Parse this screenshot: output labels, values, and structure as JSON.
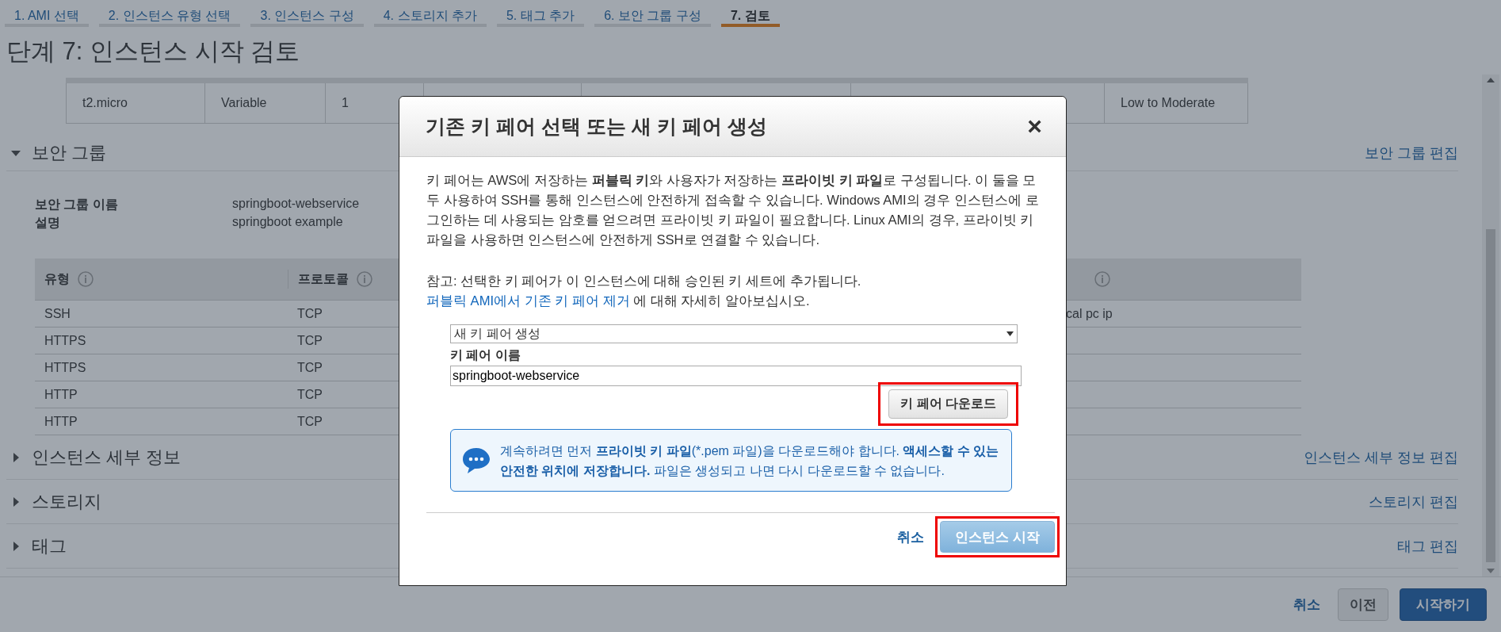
{
  "tabs": [
    {
      "label": "1. AMI 선택",
      "selected": false
    },
    {
      "label": "2. 인스턴스 유형 선택",
      "selected": false
    },
    {
      "label": "3. 인스턴스 구성",
      "selected": false
    },
    {
      "label": "4. 스토리지 추가",
      "selected": false
    },
    {
      "label": "5. 태그 추가",
      "selected": false
    },
    {
      "label": "6. 보안 그룹 구성",
      "selected": false
    },
    {
      "label": "7. 검토",
      "selected": true
    }
  ],
  "page_title": "단계 7: 인스턴스 시작 검토",
  "instance_table": {
    "rows": [
      [
        "t2.micro",
        "Variable",
        "1",
        null,
        null,
        null,
        "Low to Moderate"
      ]
    ]
  },
  "sections": [
    {
      "title": "보안 그룹",
      "expanded": true,
      "edit_link": "보안 그룹 편집",
      "details": [
        {
          "label": "보안 그룹 이름",
          "value": "springboot-webservice"
        },
        {
          "label": "설명",
          "value": "springboot example"
        }
      ],
      "rules_table": {
        "columns": [
          {
            "label": "유형",
            "info": true
          },
          {
            "label": "프로토콜",
            "info": true
          },
          {
            "info": true
          }
        ],
        "rows": [
          [
            "SSH",
            "TCP",
            "cal pc ip"
          ],
          [
            "HTTPS",
            "TCP",
            null
          ],
          [
            "HTTPS",
            "TCP",
            null
          ],
          [
            "HTTP",
            "TCP",
            null
          ],
          [
            "HTTP",
            "TCP",
            null
          ]
        ]
      }
    },
    {
      "title": "인스턴스 세부 정보",
      "expanded": false,
      "edit_link": "인스턴스 세부 정보 편집"
    },
    {
      "title": "스토리지",
      "expanded": false,
      "edit_link": "스토리지 편집"
    },
    {
      "title": "태그",
      "expanded": false,
      "edit_link": "태그 편집"
    }
  ],
  "footer": {
    "cancel": "취소",
    "previous": "이전",
    "launch": "시작하기"
  },
  "modal": {
    "title": "기존 키 페어 선택 또는 새 키 페어 생성",
    "close": "×",
    "intro": "키 페어는 AWS에 저장하는 **퍼블릭 키**와 사용자가 저장하는 **프라이빗 키 파일**로 구성됩니다. 이 둘을 모두 사용하여 SSH를 통해 인스턴스에 안전하게 접속할 수 있습니다. Windows AMI의 경우 인스턴스에 로그인하는 데 사용되는 암호를 얻으려면 프라이빗 키 파일이 필요합니다. Linux AMI의 경우, 프라이빗 키 파일을 사용하면 인스턴스에 안전하게 SSH로 연결할 수 있습니다.",
    "note": {
      "before": "참고: 선택한 키 페어가 이 인스턴스에 대해 승인된 키 세트에 추가됩니다.",
      "link": "퍼블릭 AMI에서 기존 키 페어 제거",
      "after": "에 대해 자세히 알아보십시오."
    },
    "key_pair_select": {
      "value": "새 키 페어 생성"
    },
    "key_pair_name": {
      "label": "키 페어 이름",
      "value": "springboot-webservice"
    },
    "download_button": {
      "label": "키 페어 다운로드",
      "highlighted": true
    },
    "info_message": "계속하려면 먼저 **프라이빗 키 파일**(*.pem 파일)을 다운로드해야 합니다. **액세스할 수 있는 안전한 위치에 저장합니다.** 파일은 생성되고 나면 다시 다운로드할 수 없습니다.",
    "cancel": "취소",
    "launch_button": {
      "label": "인스턴스 시작",
      "disabled": true,
      "highlighted": true
    }
  }
}
